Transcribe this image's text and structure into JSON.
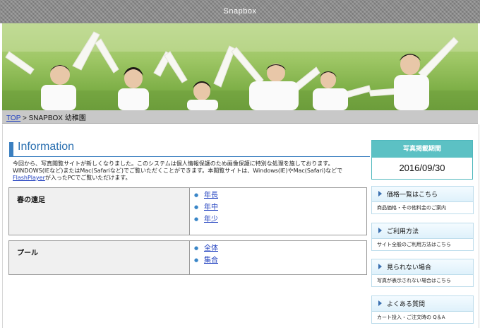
{
  "site": {
    "title": "Snapbox"
  },
  "breadcrumb": {
    "top_link": "TOP",
    "separator": " > ",
    "current": "SNAPBOX 幼稚園"
  },
  "info": {
    "heading": "Information",
    "intro_before_link": "今回から、写真閲覧サイトが新しくなりました。このシステムは個人情報保護のため画像保護に特別な処理を施しております。WINDOWS(IEなど)またはMac(Safariなど)でご覧いただくことができます。本閲覧サイトは、Windows(IE)やMac(Safari)などで",
    "intro_link": "FlashPlayer",
    "intro_after_link": "が入ったPCでご覧いただけます。"
  },
  "albums": [
    {
      "label": "春の遠足",
      "links": [
        "年長",
        "年中",
        "年少"
      ]
    },
    {
      "label": "プール",
      "links": [
        "全体",
        "集合"
      ]
    }
  ],
  "sidebar": {
    "period_title": "写真掲載期間",
    "period_date": "2016/09/30",
    "menu": [
      {
        "title": "価格一覧はこちら",
        "sub": "商品価格・その他料金のご案内"
      },
      {
        "title": "ご利用方法",
        "sub": "サイト全般のご利用方法はこちら"
      },
      {
        "title": "見られない場合",
        "sub": "写真が表示されない場合はこちら"
      },
      {
        "title": "よくある質問",
        "sub": "カート投入・ご注文時の Q＆A"
      }
    ]
  },
  "colors": {
    "accent_blue": "#3a7fc0",
    "teal": "#5cc1c4",
    "link": "#1f3fbf"
  }
}
